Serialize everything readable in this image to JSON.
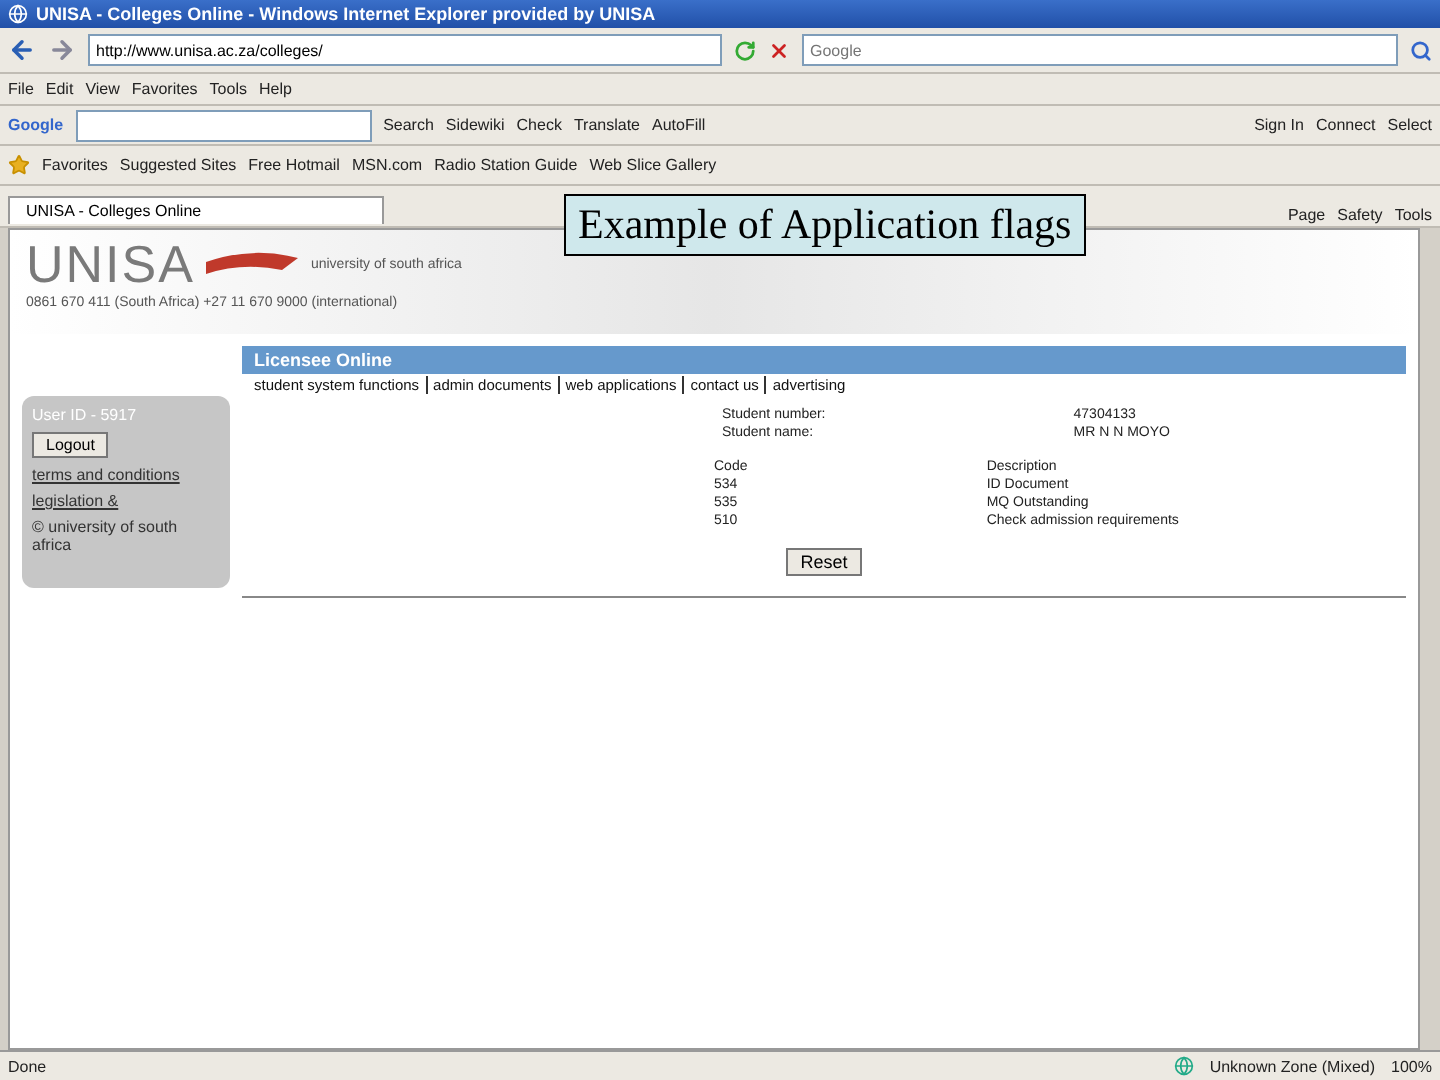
{
  "window": {
    "title": "UNISA - Colleges Online - Windows Internet Explorer provided by UNISA"
  },
  "address_bar": {
    "value": "http://www.unisa.ac.za/colleges/"
  },
  "search": {
    "placeholder": "Google"
  },
  "menu": [
    "File",
    "Edit",
    "View",
    "Favorites",
    "Tools",
    "Help"
  ],
  "google_toolbar": {
    "label": "Google",
    "buttons": [
      "Search",
      "Sidewiki",
      "Check",
      "Translate",
      "AutoFill"
    ],
    "right_buttons": [
      "Sign In",
      "Connect",
      "Select"
    ]
  },
  "favorites_bar": [
    "Favorites",
    "Suggested Sites",
    "Free Hotmail",
    "MSN.com",
    "Radio Station Guide",
    "Web Slice Gallery"
  ],
  "tabs": [
    {
      "label": "UNISA - Colleges Online",
      "selected": true
    }
  ],
  "command_bar": [
    "Page",
    "Safety",
    "Tools"
  ],
  "site": {
    "logo": "UNISA",
    "tagline": "university of south africa",
    "phone": "0861 670 411 (South Africa) +27 11 670 9000 (international)",
    "nav_title": "Licensee Online",
    "nav_links": [
      "student system functions",
      "admin documents",
      "web applications",
      "contact us",
      "advertising"
    ]
  },
  "sidebar": {
    "user": "User ID - 5917",
    "logout": "Logout",
    "links": [
      "terms and conditions",
      "legislation &"
    ],
    "copyright": "© university of south africa"
  },
  "student": [
    {
      "label": "Student number:",
      "value": "47304133"
    },
    {
      "label": "Student name:",
      "value": "MR N N MOYO"
    }
  ],
  "flags": {
    "header": [
      "Code",
      "Description"
    ],
    "rows": [
      {
        "code": "534",
        "description": "ID Document"
      },
      {
        "code": "535",
        "description": "MQ Outstanding"
      },
      {
        "code": "510",
        "description": "Check admission requirements"
      }
    ]
  },
  "reset_button": "Reset",
  "status_bar": {
    "status": "Done",
    "zone": "Unknown Zone (Mixed)",
    "zoom": "100%"
  },
  "callout": "Example of Application flags"
}
